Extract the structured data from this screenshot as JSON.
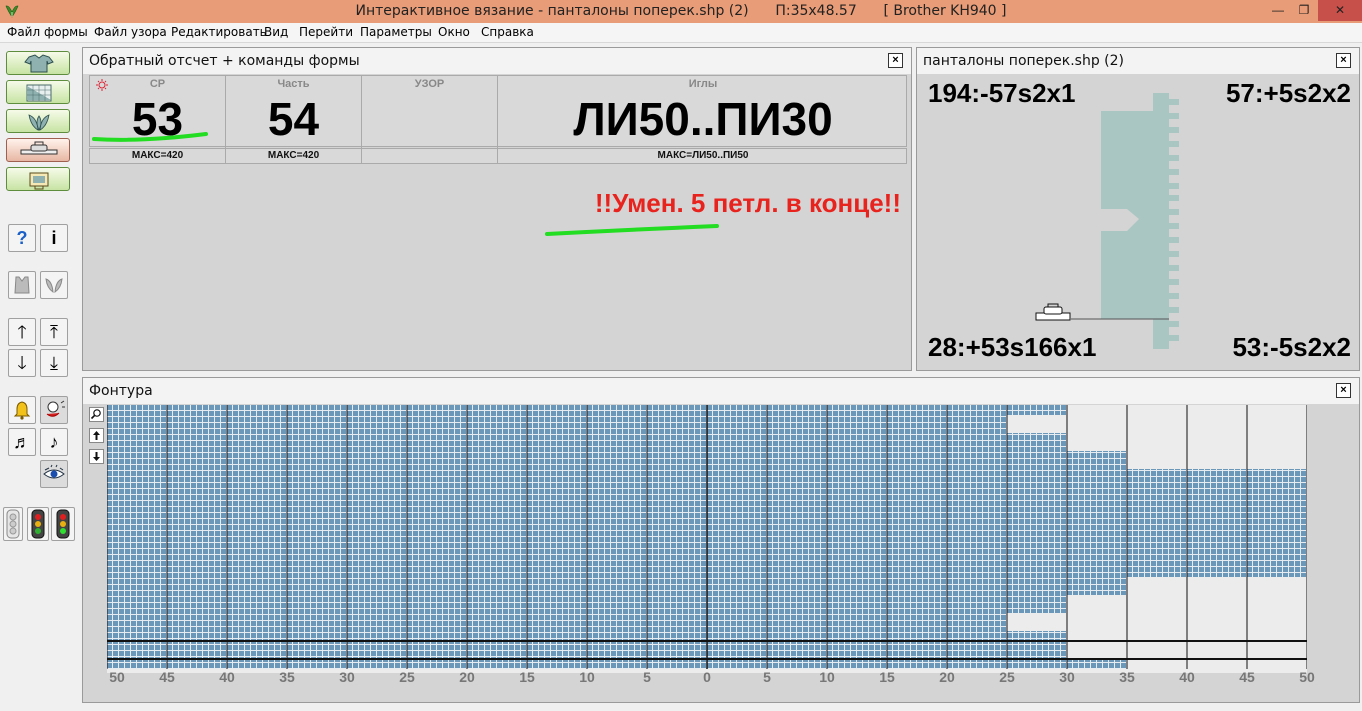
{
  "titlebar": {
    "title": "Интерактивное вязание - панталоны поперек.shp (2)      П:35x48.57      [ Brother KH940 ]",
    "min_label": "—",
    "max_label": "❐",
    "close_label": "✕"
  },
  "menu": [
    "Файл формы",
    "Файл узора",
    "Редактировать",
    "Вид",
    "Перейти",
    "Параметры",
    "Окно",
    "Справка"
  ],
  "toolbar": {
    "help": "?",
    "info": "i",
    "up": "🡑",
    "top": "⤒",
    "down": "🡓",
    "bottom": "⤓",
    "note1": "♬",
    "note2": "♪"
  },
  "counter_panel": {
    "title": "Обратный отсчет + команды формы",
    "close": "×",
    "cells": [
      {
        "label": "СР",
        "value": "53",
        "max": "МАКС=420"
      },
      {
        "label": "Часть",
        "value": "54",
        "max": "МАКС=420"
      },
      {
        "label": "УЗОР",
        "value": "",
        "max": ""
      },
      {
        "label": "Иглы",
        "value": "ЛИ50..ПИ30",
        "max": "МАКС=ЛИ50..ПИ50"
      }
    ],
    "instruction": "!!Умен. 5 петл. в конце!!",
    "instruction_color": "#e8231e",
    "highlight_color": "#22dd22"
  },
  "shape_panel": {
    "title": "панталоны поперек.shp (2)",
    "close": "×",
    "top_left": "194:-57s2x1",
    "top_right": "57:+5s2x2",
    "bottom_left": "28:+53s166x1",
    "bottom_right": "53:-5s2x2",
    "shape_color": "#a9c6c2"
  },
  "contour_panel": {
    "title": "Фонтура",
    "close": "×",
    "stitch_color": "#6b97b8",
    "axis_labels": [
      "50",
      "45",
      "40",
      "35",
      "30",
      "25",
      "20",
      "15",
      "10",
      "5",
      "0",
      "5",
      "10",
      "15",
      "20",
      "25",
      "30",
      "35",
      "40",
      "45",
      "50"
    ]
  }
}
